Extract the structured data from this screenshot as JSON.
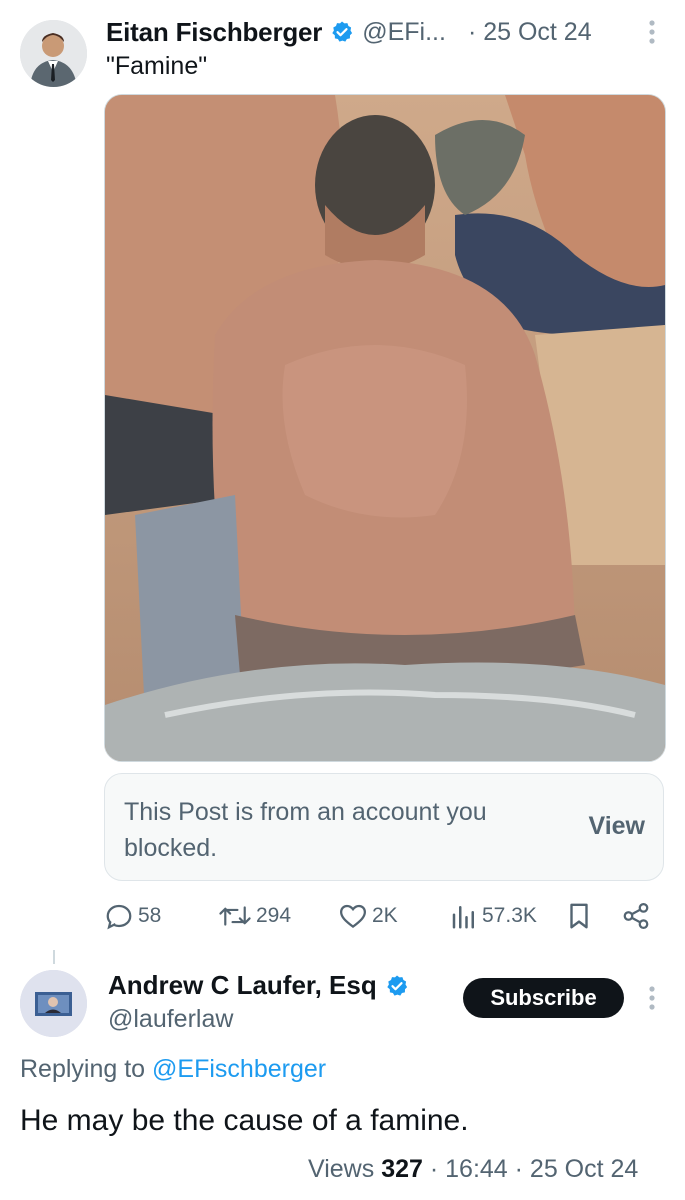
{
  "tweet": {
    "author_name": "Eitan Fischberger",
    "handle": "@EFi...",
    "date": "· 25 Oct 24",
    "text": "\"Famine\"",
    "blocked_notice": "This Post is from an account you blocked.",
    "blocked_view_label": "View",
    "stats": {
      "replies": "58",
      "reposts": "294",
      "likes": "2K",
      "views": "57.3K"
    }
  },
  "reply": {
    "author_name": "Andrew C Laufer, Esq",
    "handle": "@lauferlaw",
    "subscribe_label": "Subscribe",
    "replying_prefix": "Replying to",
    "replying_to": "@EFischberger",
    "text": "He may be the cause of a famine.",
    "views_label": "Views",
    "views_count": "327",
    "time": "· 16:44 · 25 Oct 24"
  },
  "colors": {
    "verified": "#1d9bf0",
    "mention": "#1d9bf0",
    "muted": "#536471",
    "button_bg": "#0f1419"
  },
  "icons": [
    "verified-badge-icon",
    "more-icon",
    "reply-icon",
    "repost-icon",
    "like-icon",
    "views-icon",
    "bookmark-icon",
    "share-icon"
  ]
}
